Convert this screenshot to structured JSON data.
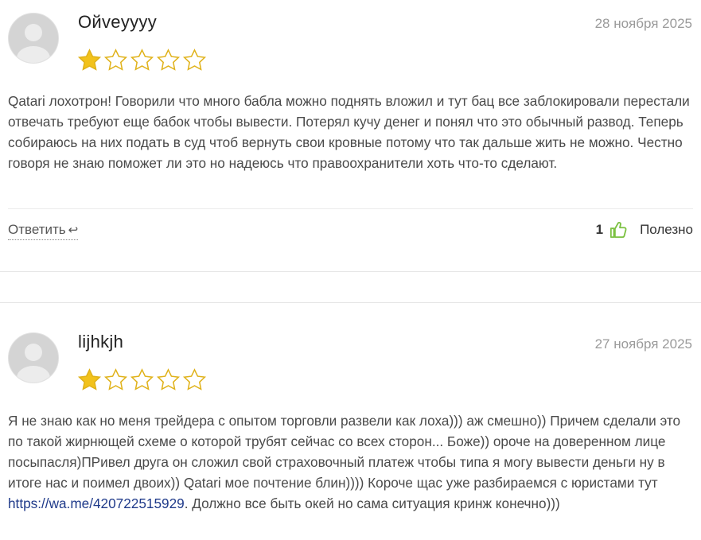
{
  "reviews": [
    {
      "author": "Ойveyyyy",
      "date": "28 ноября 2025",
      "rating": 1,
      "max_rating": 5,
      "text": "Qatari лохотрон! Говорили что много бабла можно поднять вложил и тут бац все заблокировали перестали отвечать требуют еще бабок чтобы вывести. Потерял кучу денег и понял что это обычный развод. Теперь собираюсь на них подать в суд чтоб вернуть свои кровные потому что так дальше жить не можно. Честно говоря не знаю поможет ли это но надеюсь что правоохранители хоть что-то сделают.",
      "reply_label": "Ответить",
      "reply_icon": "↩",
      "helpful_count": "1",
      "helpful_label": "Полезно"
    },
    {
      "author": "lijhkjh",
      "date": "27 ноября 2025",
      "rating": 1,
      "max_rating": 5,
      "text_before_link": "Я не знаю как но меня трейдера с опытом торговли развели как лоха))) аж смешно)) Причем сделали это по такой жирнющей схеме о которой трубят сейчас со всех сторон... Боже)) ороче на доверенном лице посыпасля)ПРивел друга он сложил свой страховочный платеж чтобы типа я могу вывести деньги ну в итоге нас и поимел двоих)) Qatari мое почтение блин)))) Короче щас уже разбираемся с юристами тут ",
      "link_text": "https://wa.me/420722515929",
      "text_after_link": ". Должно все быть окей но сама ситуация кринж конечно)))"
    }
  ],
  "colors": {
    "star_filled": "#f2c21b",
    "star_outline": "#e0b21a",
    "thumb_icon": "#7cc142",
    "date_text": "#9a9a9a",
    "link": "#1f3a8a"
  },
  "icons": {
    "avatar": "user-avatar-placeholder-icon",
    "star": "star-icon",
    "thumb": "thumbs-up-icon"
  }
}
